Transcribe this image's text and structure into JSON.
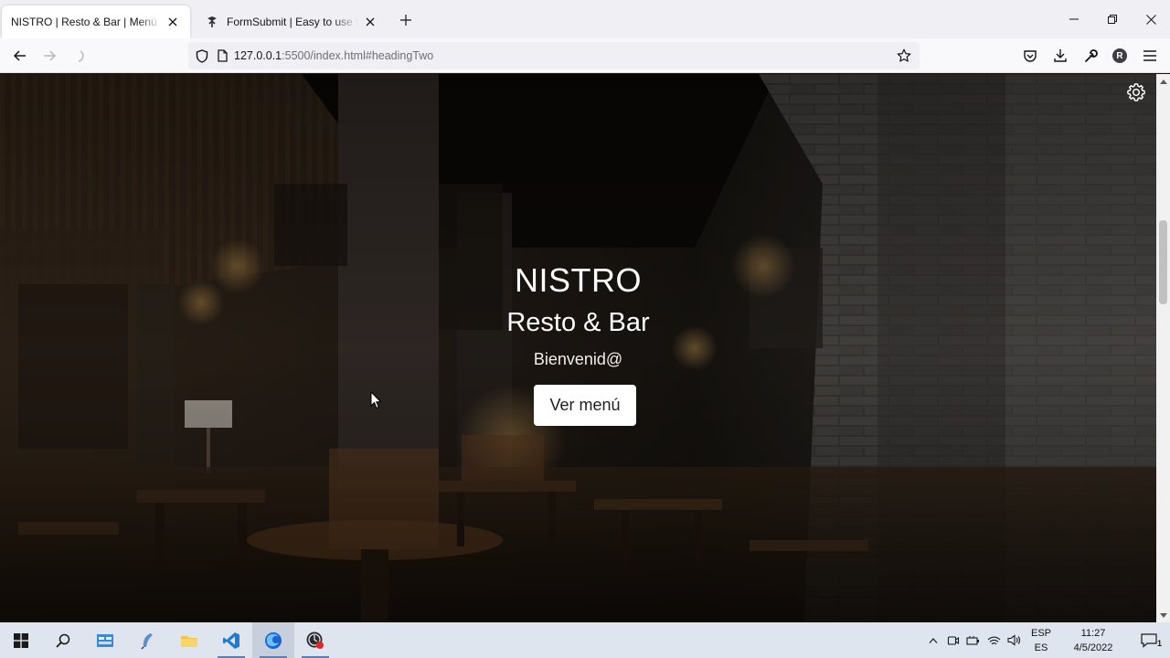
{
  "browser": {
    "tabs": [
      {
        "title": "NISTRO | Resto & Bar | Menú digital",
        "active": true
      },
      {
        "title": "FormSubmit | Easy to use form backend",
        "active": false
      }
    ],
    "url": {
      "host": "127.0.0.1",
      "path": ":5500/index.html#headingTwo"
    }
  },
  "hero": {
    "title": "NISTRO",
    "subtitle": "Resto & Bar",
    "welcome": "Bienvenid@",
    "button_label": "Ver menú"
  },
  "taskbar": {
    "language": {
      "line1": "ESP",
      "line2": "ES"
    },
    "clock": {
      "time": "11:27",
      "date": "4/5/2022"
    },
    "notification_count": "1"
  },
  "colors": {
    "tab_bar": "#f0f0f4",
    "nav_bar": "#f9f9fb",
    "taskbar": "#dfe5ee",
    "hero_text": "#ffffff",
    "button_bg": "#ffffff"
  }
}
